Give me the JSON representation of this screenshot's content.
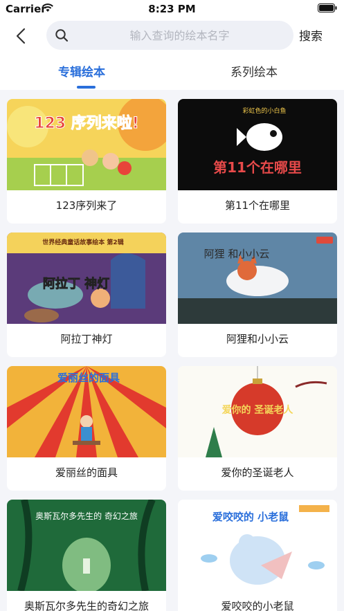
{
  "status_bar": {
    "carrier": "Carrier",
    "time": "8:23 PM"
  },
  "header": {
    "back_icon": "chevron-left-icon",
    "search_icon": "search-icon",
    "search_placeholder": "输入查询的绘本名字",
    "search_value": "",
    "search_button": "搜索"
  },
  "tabs": [
    {
      "label": "专辑绘本",
      "active": true
    },
    {
      "label": "系列绘本",
      "active": false
    }
  ],
  "accent_color": "#2a6fdb",
  "books": [
    {
      "title": "123序列来了",
      "cover_text": "123 序列来啦!"
    },
    {
      "title": "第11个在哪里",
      "cover_text": "第11个在哪里",
      "cover_subtitle": "彩虹色的小白鱼"
    },
    {
      "title": "阿拉丁神灯",
      "cover_text": "阿拉丁 神灯",
      "cover_series": "世界经典童话故事绘本 第2辑"
    },
    {
      "title": "阿狸和小小云",
      "cover_text": "阿狸 和小小云"
    },
    {
      "title": "爱丽丝的面具",
      "cover_text": "爱丽丝的面具"
    },
    {
      "title": "爱你的圣诞老人",
      "cover_text": "爱你的 圣诞老人"
    },
    {
      "title": "奥斯瓦尔多先生的奇幻之旅",
      "cover_text": "奥斯瓦尔多先生的 奇幻之旅"
    },
    {
      "title": "爱咬咬的小老鼠",
      "cover_text": "爱咬咬的 小老鼠"
    }
  ]
}
